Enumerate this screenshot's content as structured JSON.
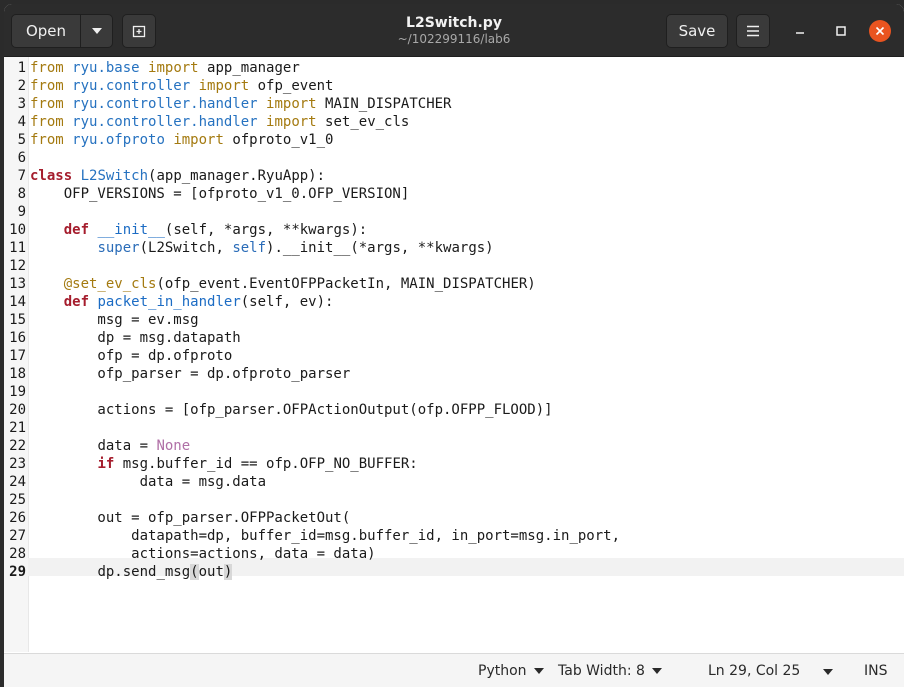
{
  "header": {
    "open_label": "Open",
    "save_label": "Save",
    "title": "L2Switch.py",
    "subtitle": "~/102299116/lab6"
  },
  "editor": {
    "line_numbers": [
      "1",
      "2",
      "3",
      "4",
      "5",
      "6",
      "7",
      "8",
      "9",
      "10",
      "11",
      "12",
      "13",
      "14",
      "15",
      "16",
      "17",
      "18",
      "19",
      "20",
      "21",
      "22",
      "23",
      "24",
      "25",
      "26",
      "27",
      "28",
      "29"
    ],
    "code": {
      "l1": [
        "from",
        "ryu.base",
        "import",
        "app_manager"
      ],
      "l2": [
        "from",
        "ryu.controller",
        "import",
        "ofp_event"
      ],
      "l3": [
        "from",
        "ryu.controller.handler",
        "import",
        "MAIN_DISPATCHER"
      ],
      "l4": [
        "from",
        "ryu.controller.handler",
        "import",
        "set_ev_cls"
      ],
      "l5": [
        "from",
        "ryu.ofproto",
        "import",
        "ofproto_v1_0"
      ],
      "l7": [
        "class",
        "L2Switch",
        "(app_manager.RyuApp):"
      ],
      "l8": "    OFP_VERSIONS = [ofproto_v1_0.OFP_VERSION]",
      "l10": [
        "def",
        "__init__",
        "(self, *args, **kwargs):"
      ],
      "l11": [
        "super",
        "(L2Switch, ",
        "self",
        ").__init__(*args, **kwargs)"
      ],
      "l13": [
        "@set_ev_cls",
        "(ofp_event.EventOFPPacketIn, MAIN_DISPATCHER)"
      ],
      "l14": [
        "def",
        "packet_in_handler",
        "(self, ev):"
      ],
      "l15": "        msg = ev.msg",
      "l16": "        dp = msg.datapath",
      "l17": "        ofp = dp.ofproto",
      "l18": "        ofp_parser = dp.ofproto_parser",
      "l20": "        actions = [ofp_parser.OFPActionOutput(ofp.OFPP_FLOOD)]",
      "l22": [
        "data = ",
        "None"
      ],
      "l23": [
        "if",
        " msg.buffer_id == ofp.OFP_NO_BUFFER:"
      ],
      "l24": "             data = msg.data",
      "l26": "        out = ofp_parser.OFPPacketOut(",
      "l27": "            datapath=dp, buffer_id=msg.buffer_id, in_port=msg.in_port,",
      "l28": "            actions=actions, data = data)",
      "l29": [
        "dp.send_msg",
        "(",
        "out",
        ")"
      ]
    }
  },
  "status": {
    "language": "Python",
    "tab_width": "Tab Width: 8",
    "position": "Ln 29, Col 25",
    "mode": "INS"
  },
  "colors": {
    "keyword": "#a51d2d",
    "import": "#a47a10",
    "module": "#2672c0",
    "close_button": "#e95420"
  }
}
